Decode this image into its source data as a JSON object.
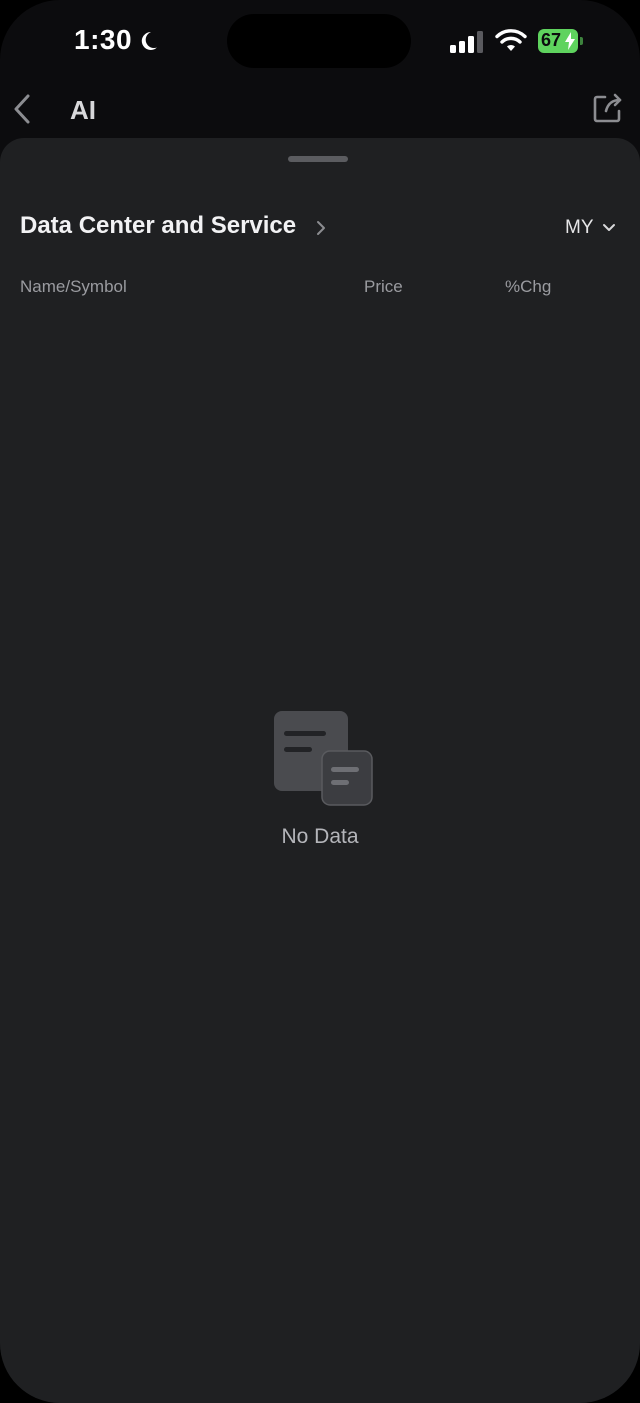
{
  "status_bar": {
    "time": "1:30",
    "battery_percent": "67",
    "icons": [
      "moon-icon",
      "signal-icon",
      "wifi-icon",
      "battery-icon"
    ]
  },
  "nav": {
    "title": "AI",
    "icons": [
      "back-chevron-icon",
      "share-icon"
    ]
  },
  "section": {
    "title": "Data Center and Service",
    "market": "MY"
  },
  "table": {
    "columns": [
      "Name/Symbol",
      "Price",
      "%Chg"
    ]
  },
  "empty_state": {
    "text": "No Data"
  },
  "colors": {
    "sheet_background": "#1f2022",
    "page_background": "#0c0c0e",
    "battery": "#5fd35e",
    "muted_text": "#9a9ba0"
  }
}
